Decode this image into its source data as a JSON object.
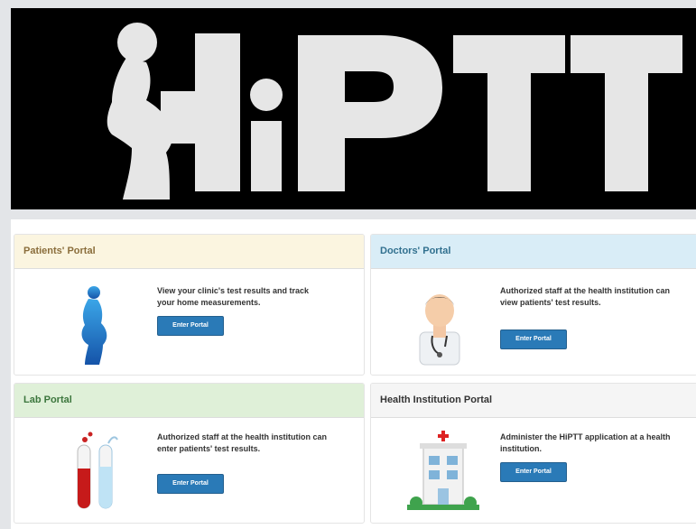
{
  "banner": {
    "logo_text": "HiPTT",
    "logo_icon": "pregnant-silhouette-icon"
  },
  "portals": [
    {
      "title": "Patients' Portal",
      "description": "View your clinic's test results and track your home measurements.",
      "button": "Enter Portal",
      "icon": "pregnant-woman-icon",
      "header_color": "#fbf5e0"
    },
    {
      "title": "Doctors' Portal",
      "description": "Authorized staff at the health institution can view patients' test results.",
      "button": "Enter Portal",
      "icon": "doctor-icon",
      "header_color": "#d9edf7"
    },
    {
      "title": "Lab Portal",
      "description": "Authorized staff at the health institution can enter patients' test results.",
      "button": "Enter Portal",
      "icon": "test-tubes-icon",
      "header_color": "#dff0d8"
    },
    {
      "title": "Health Institution Portal",
      "description": "Administer the HiPTT application at a health institution.",
      "button": "Enter Portal",
      "icon": "hospital-icon",
      "header_color": "#f5f5f5"
    }
  ],
  "colors": {
    "button": "#2a7ab7",
    "banner_bg": "#000000"
  }
}
